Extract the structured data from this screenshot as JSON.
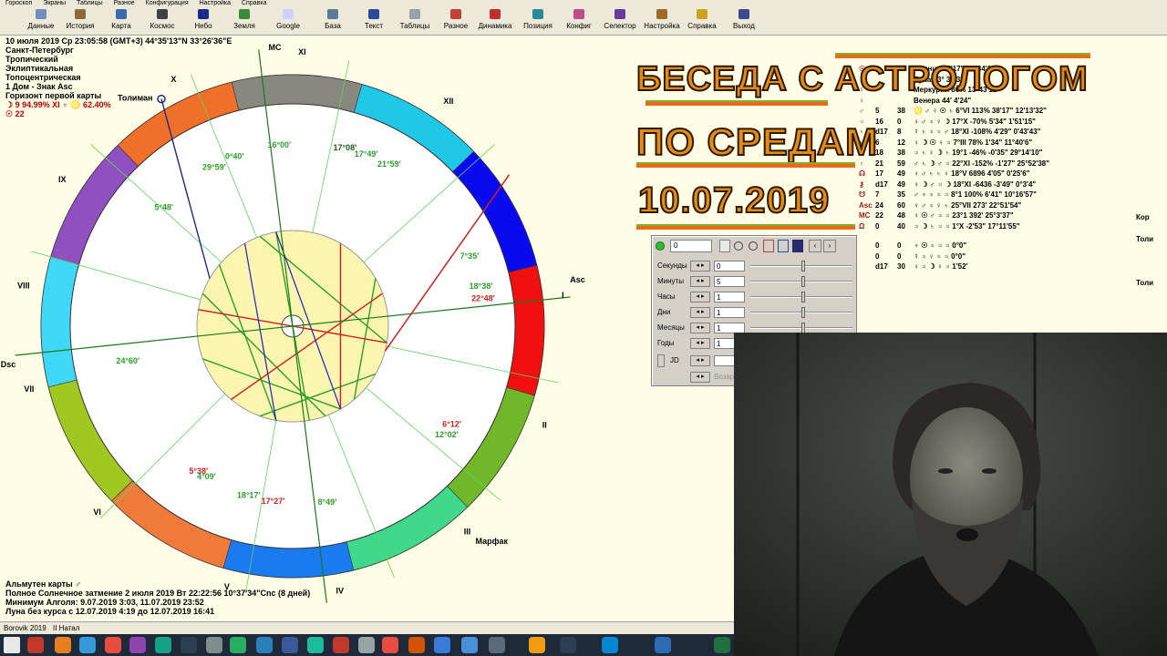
{
  "menu": [
    "Гороскоп",
    "Экраны",
    "Таблицы",
    "Разное",
    "Конфигурация",
    "Настройка",
    "Справка"
  ],
  "toolbar": [
    {
      "label": "Данные",
      "color": "#6f8fbf"
    },
    {
      "label": "История",
      "color": "#8a6a3a"
    },
    {
      "label": "Карта",
      "color": "#3a6ab0"
    },
    {
      "label": "Космос",
      "color": "#404040"
    },
    {
      "label": "Небо",
      "color": "#1a2a8a"
    },
    {
      "label": "Земля",
      "color": "#3a8a3a"
    },
    {
      "label": "Google",
      "color": "#d0d0ff"
    },
    {
      "label": "База",
      "color": "#5a7a9a"
    },
    {
      "label": "Текст",
      "color": "#2a4a9a"
    },
    {
      "label": "Таблицы",
      "color": "#9aa0a8"
    },
    {
      "label": "Разное",
      "color": "#c04040"
    },
    {
      "label": "Динамика",
      "color": "#c03030"
    },
    {
      "label": "Позиция",
      "color": "#2a8a9a"
    },
    {
      "label": "Конфиг",
      "color": "#c04a8a"
    },
    {
      "label": "Селектор",
      "color": "#6a3a9a"
    },
    {
      "label": "Настройка",
      "color": "#a06a2a"
    },
    {
      "label": "Справка",
      "color": "#d0a020"
    },
    {
      "label": "Выход",
      "color": "#3a4a8a"
    }
  ],
  "header": {
    "line1": "10 июля 2019  Ср   23:05:58 (GMT+3) 44°35'13\"N  33°26'36\"E",
    "line2": "Санкт-Петербург",
    "line3": "Тропический",
    "line4": "Эклиптикальная",
    "line5": "Топоцентрическая",
    "line6": "1 Дом - Знак Asc",
    "line7": "Горизонт первой карты",
    "line8": "☽  9 94.99% XI  ♅ ♌ 62.40%",
    "line9": "☉  22"
  },
  "footer": {
    "l1": "Альмутен карты  ♂",
    "l2": "Полное Солнечное затмение 2 июля 2019 Вт 22:22:56 10°37'34\"Cnc (8 дней)",
    "l3": "Минимум Алголя: 9.07.2019  3:03,  11.07.2019 23:52",
    "l4": "Луна без курса с 12.07.2019  4:19 до 12.07.2019 16:41"
  },
  "wheel": {
    "houses": [
      "I",
      "II",
      "III",
      "IV",
      "V",
      "VI",
      "VII",
      "VIII",
      "IX",
      "X",
      "XI",
      "XII"
    ],
    "houseLabels": {
      "asc": "Asc",
      "dsc": "Dsc",
      "mc": "MC"
    },
    "stars": {
      "toliman": "Толиман",
      "marfak": "Марфак"
    },
    "planets": [
      {
        "t": "17°08'",
        "c": "#1a5a1a"
      },
      {
        "t": "17°49'",
        "c": "#2aa02a"
      },
      {
        "t": "21°59'",
        "c": "#2aa02a"
      },
      {
        "t": "16°00'",
        "c": "#2aa02a"
      },
      {
        "t": "0°40'",
        "c": "#2aa02a"
      },
      {
        "t": "29°59'",
        "c": "#2aa02a"
      },
      {
        "t": "5°48'",
        "c": "#2aa02a"
      },
      {
        "t": "7°35'",
        "c": "#2aa02a"
      },
      {
        "t": "18°38'",
        "c": "#2aa02a"
      },
      {
        "t": "22°48'",
        "c": "#d02020"
      },
      {
        "t": "24°60'",
        "c": "#2aa02a"
      },
      {
        "t": "6°12'",
        "c": "#d02020"
      },
      {
        "t": "12°02'",
        "c": "#2aa02a"
      },
      {
        "t": "5°38'",
        "c": "#d02020"
      },
      {
        "t": "4°09'",
        "c": "#2aa02a"
      },
      {
        "t": "18°17'",
        "c": "#2aa02a"
      },
      {
        "t": "17°27'",
        "c": "#d02020"
      },
      {
        "t": "8°49'",
        "c": "#2aa02a"
      }
    ]
  },
  "title": {
    "line1": "БЕСЕДА С АСТРОЛОГОМ",
    "line2": "ПО СРЕДАМ",
    "line3": "10.07.2019"
  },
  "ptable": [
    [
      "Солнце",
      "",
      "",
      "",
      "",
      "",
      "",
      "",
      "",
      ""
    ],
    [
      "",
      "",
      "",
      "",
      "",
      "",
      "17°17' 29°34'29\"",
      ""
    ],
    [
      "♀  16",
      "0",
      "♀",
      "♂",
      "♃",
      "",
      "17 X   -70%  5'34\"   1'51'15\"",
      ""
    ],
    [
      "♄  d17",
      "8",
      "☿",
      "♄",
      "♃",
      "",
      "18°XI  -108%  4'29\"  0°43'43\"",
      ""
    ],
    [
      "☿  d17",
      "49",
      "♀",
      "♅",
      "♃",
      "",
      "18°XI  -6436  3'49\"  0°3'4\"",
      ""
    ],
    [
      "♃  7",
      "35",
      "♆",
      "♃",
      "♃",
      "",
      "8°I   100%  6'41\"  10°16'57\"",
      ""
    ]
  ],
  "ptableRows": [
    {
      "g": "☉",
      "a": "",
      "b": "",
      "rest": "Солнце                                   17'17\"  29°34'29\""
    },
    {
      "g": "☽",
      "a": "",
      "b": "",
      "rest": "Луна                                     13°   3'23\""
    },
    {
      "g": "☿",
      "a": "",
      "b": "",
      "rest": "Меркурий                                 86%  13°43'12\""
    },
    {
      "g": "♀",
      "a": "",
      "b": "",
      "rest": "Венера                                   44'   4'24\""
    },
    {
      "g": "♂",
      "a": "5",
      "b": "38",
      "rest": "♌  ♂  ♀   ☉   ♄    6°VI   113%  38'17\"  12'13'32\""
    },
    {
      "g": "♃",
      "a": "16",
      "b": "0",
      "rest": "♀  ♂  ♃   ♀   ☽   17°X   -70%   5'34\"   1'51'15\""
    },
    {
      "g": "♄",
      "a": "d17",
      "b": "8",
      "rest": "☿  ♄  ♃   ♃   ♂   18°XI  -108%  4'29\"  0'43'43\""
    },
    {
      "g": "♅",
      "a": "6",
      "b": "12",
      "rest": "♀  ☽  ☉   ♀   ♃    7°III   78%  1'34\"  11°40'6\""
    },
    {
      "g": "♆",
      "a": "18",
      "b": "38",
      "rest": "♃  ♄  ♀   ☽   ♄   19°1   -46%  -0'35\"  29°14'10\""
    },
    {
      "g": "♇",
      "a": "21",
      "b": "59",
      "rest": "♂  ♄  ☽   ♂   ♃   22°XI  -152%  -1'27\"  25°52'38\""
    },
    {
      "g": "☊",
      "a": "17",
      "b": "49",
      "rest": "♀  ♂  ♄   ♄   ♀   18°V   6896   4'05\"   0'25'6\""
    },
    {
      "g": "⚷",
      "a": "d17",
      "b": "49",
      "rest": "♀  ☽  ♂   ♃   ☽   18°XI  -6436  -3'49\"  0°3'4\""
    },
    {
      "g": "☋",
      "a": "7",
      "b": "35",
      "rest": "♂  ♆  ♃   ♃   ♃    8°1   100%   6'41\"  10°16'57\""
    },
    {
      "g": "Asc",
      "a": "24",
      "b": "60",
      "rest": "♀  ♂  ♃   ♀   ♄   25°VII        273'  22°51'54\""
    },
    {
      "g": "MC",
      "a": "22",
      "b": "48",
      "rest": "♀  ☉  ♂   ♃   ♃   23°1          392'  25°3'37\""
    },
    {
      "g": "Ω",
      "a": "0",
      "b": "40",
      "rest": "♃  ☽  ♄   ♃   ♃    1°X       -2'53\"  17°11'55\""
    }
  ],
  "ptableRight": {
    "r1": "Кор",
    "r2": "Толи",
    "r3": "Толи"
  },
  "ptable2": [
    {
      "a": "0",
      "b": "0",
      "rest": "♆  ☉  ♃  ♃   ♃     0°0\""
    },
    {
      "a": "0",
      "b": "0",
      "rest": "☿  ♃  ♀  ♃   ♃     0°0\""
    },
    {
      "a": "d17",
      "b": "30",
      "rest": "♀  ♃  ☽  ♀   ♃     1'52'"
    }
  ],
  "timepanel": {
    "field": "0",
    "rows": [
      {
        "label": "Секунды",
        "value": "0"
      },
      {
        "label": "Минуты",
        "value": "5"
      },
      {
        "label": "Часы",
        "value": "1"
      },
      {
        "label": "Дни",
        "value": "1"
      },
      {
        "label": "Месяцы",
        "value": "1"
      },
      {
        "label": "Годы",
        "value": "1"
      }
    ],
    "jd": "JD",
    "hint": "Возвр"
  },
  "status": {
    "s1": "Borovik 2019",
    "s2": "II Натал"
  },
  "taskbar": [
    "#c0392b",
    "#e67e22",
    "#3498db",
    "#e74c3c",
    "#8e44ad",
    "#16a085",
    "#2c3e50",
    "#7f8c8d",
    "#27ae60",
    "#2980b9",
    "#3b5998",
    "#1abc9c",
    "#c0392b",
    "#95a5a6",
    "#e84c3d",
    "#d35400",
    "#3a7bd5",
    "#4a90d9",
    "#5a6a7a",
    "#f39c12",
    "#2c3e50",
    "#0288d1",
    "#2d6cb5",
    "#1f6f3f"
  ]
}
